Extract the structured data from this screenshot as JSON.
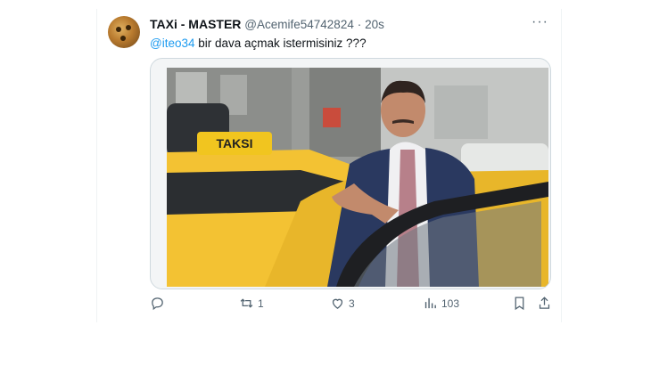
{
  "tweet": {
    "display_name": "TAXi - MASTER",
    "handle": "@Acemife54742824",
    "separator": "·",
    "time": "20s",
    "more_label": "···",
    "mention": "@iteo34",
    "body": " bir dava açmak istermisiniz ???"
  },
  "media": {
    "sign_text": "TAKSI",
    "taxi_color": "#f3c233"
  },
  "actions": {
    "reply_icon": "reply-icon",
    "retweet_count": "1",
    "like_count": "3",
    "views_count": "103"
  },
  "colors": {
    "accent": "#1d9bf0",
    "muted": "#536471",
    "border": "#cfd9de"
  }
}
